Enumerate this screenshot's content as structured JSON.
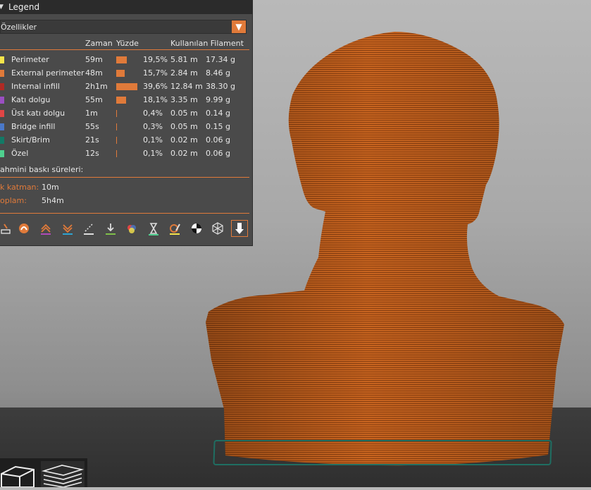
{
  "legend": {
    "title": "Legend",
    "view_type": "Özellikler",
    "columns": {
      "time": "Zaman",
      "percent": "Yüzde",
      "used_filament": "Kullanılan Filament"
    },
    "rows": [
      {
        "label": "Perimeter",
        "color": "#f5e44a",
        "time": "59m",
        "percent": "19,5%",
        "length": "5.81 m",
        "weight": "17.34 g",
        "fraction": 0.195
      },
      {
        "label": "External perimeter",
        "color": "#e07a3a",
        "time": "48m",
        "percent": "15,7%",
        "length": "2.84 m",
        "weight": "8.46 g",
        "fraction": 0.157
      },
      {
        "label": "Internal infill",
        "color": "#b02a24",
        "time": "2h1m",
        "percent": "39,6%",
        "length": "12.84 m",
        "weight": "38.30 g",
        "fraction": 0.396
      },
      {
        "label": "Katı dolgu",
        "color": "#9a4fc2",
        "time": "55m",
        "percent": "18,1%",
        "length": "3.35 m",
        "weight": "9.99 g",
        "fraction": 0.181
      },
      {
        "label": "Üst katı dolgu",
        "color": "#e04545",
        "time": "1m",
        "percent": "0,4%",
        "length": "0.05 m",
        "weight": "0.14 g",
        "fraction": 0.004
      },
      {
        "label": "Bridge infill",
        "color": "#4a78c8",
        "time": "55s",
        "percent": "0,3%",
        "length": "0.05 m",
        "weight": "0.15 g",
        "fraction": 0.003
      },
      {
        "label": "Skirt/Brim",
        "color": "#137a66",
        "time": "21s",
        "percent": "0,1%",
        "length": "0.02 m",
        "weight": "0.06 g",
        "fraction": 0.001
      },
      {
        "label": "Özel",
        "color": "#4fd08f",
        "time": "12s",
        "percent": "0,1%",
        "length": "0.02 m",
        "weight": "0.06 g",
        "fraction": 0.001
      }
    ],
    "estimated_title": "ahmini baskı süreleri:",
    "first_layer_label": "k katman:",
    "first_layer_value": "10m",
    "total_label": "oplam:",
    "total_value": "5h4m"
  },
  "accent_color": "#e07a3a"
}
